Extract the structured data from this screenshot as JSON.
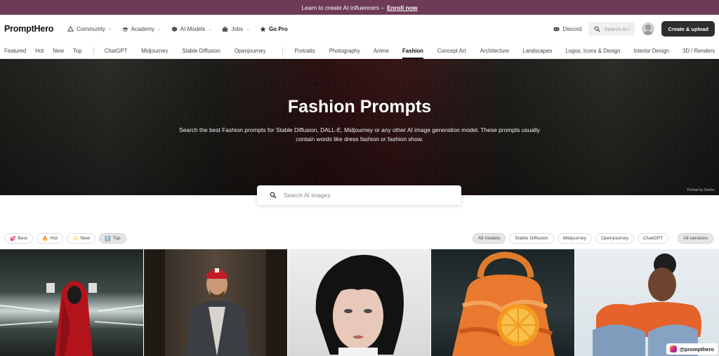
{
  "announcement": {
    "text": "Learn to create AI influencers –",
    "link": "Enroll now"
  },
  "header": {
    "logo": "PromptHero",
    "nav": [
      {
        "label": "Community",
        "icon": "community-icon",
        "has_caret": true
      },
      {
        "label": "Academy",
        "icon": "graduation-cap-icon",
        "has_caret": true
      },
      {
        "label": "AI Models",
        "icon": "cube-icon",
        "has_caret": true
      },
      {
        "label": "Jobs",
        "icon": "briefcase-icon",
        "has_caret": true
      },
      {
        "label": "Go Pro",
        "icon": "star-icon",
        "has_caret": false
      }
    ],
    "discord_label": "Discord",
    "search_placeholder": "Search AI i",
    "create_button": "Create & upload"
  },
  "categories": {
    "group1": [
      "Featured",
      "Hot",
      "New",
      "Top"
    ],
    "group2": [
      "ChatGPT",
      "Midjourney",
      "Stable Diffusion",
      "Openjourney"
    ],
    "group3": [
      "Portraits",
      "Photography",
      "Anime",
      "Fashion",
      "Concept Art",
      "Architecture",
      "Landscapes",
      "Logos, Icons & Design",
      "Interior Design",
      "3D / Renders"
    ],
    "active": "Fashion"
  },
  "hero": {
    "title": "Fashion Prompts",
    "description": "Search the best Fashion prompts for Stable Diffusion, DALL-E, Midjourney or any other AI image generation model. These prompts usually contain words like dress fashion or fashion show.",
    "credit": "Prompt by Sveinn",
    "search_placeholder": "Search AI images"
  },
  "sort_filters": [
    {
      "label": "Best",
      "icon": "💕"
    },
    {
      "label": "Hot",
      "icon": "🔥"
    },
    {
      "label": "New",
      "icon": "✨"
    },
    {
      "label": "Top",
      "icon": "🔝"
    }
  ],
  "active_sort": "Top",
  "model_filters": [
    "All models",
    "Stable Diffusion",
    "Midjourney",
    "Openjourney",
    "ChatGPT"
  ],
  "active_model": "All models",
  "version_filter": "All versions",
  "watermark": "@prompthero",
  "colors": {
    "announce_bg": "#6d3b57",
    "create_btn_bg": "#2e2e2e",
    "accent_orange": "#e8792e"
  }
}
